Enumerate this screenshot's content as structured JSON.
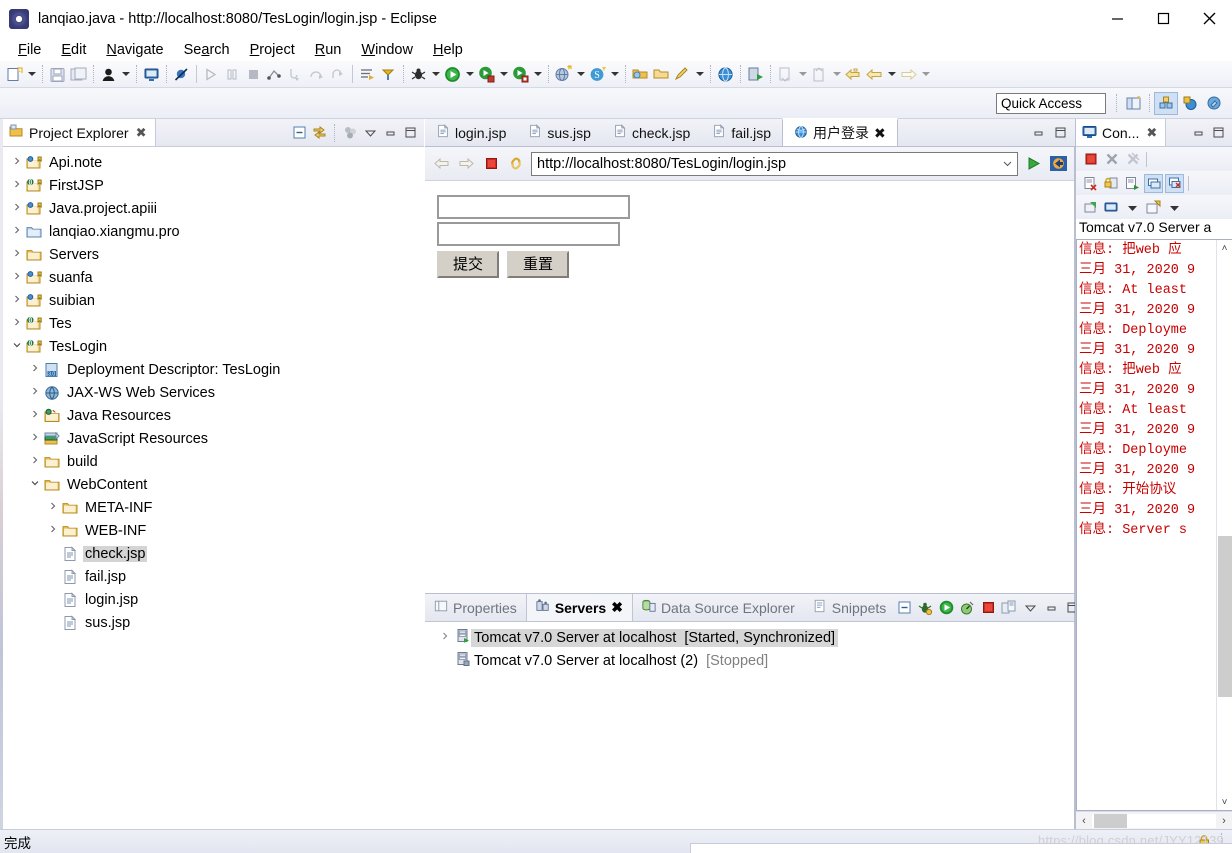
{
  "window": {
    "title": "lanqiao.java - http://localhost:8080/TesLogin/login.jsp - Eclipse",
    "app_icon": "eclipse-icon",
    "minimize": "–",
    "maximize": "☐",
    "close": "✕"
  },
  "menubar": {
    "items": [
      {
        "label": "File",
        "mnemonic": "F"
      },
      {
        "label": "Edit",
        "mnemonic": "E"
      },
      {
        "label": "Navigate",
        "mnemonic": "N"
      },
      {
        "label": "Search",
        "mnemonic": "a"
      },
      {
        "label": "Project",
        "mnemonic": "P"
      },
      {
        "label": "Run",
        "mnemonic": "R"
      },
      {
        "label": "Window",
        "mnemonic": "W"
      },
      {
        "label": "Help",
        "mnemonic": "H"
      }
    ]
  },
  "quick_access": {
    "value": "Quick Access",
    "placeholder": "Quick Access"
  },
  "explorer": {
    "tab_label": "Project Explorer",
    "close_glyph": "✖",
    "tree": [
      {
        "label": "Api.note",
        "indent": 0,
        "twist": "›",
        "icon": "java-project-icon"
      },
      {
        "label": "FirstJSP",
        "indent": 0,
        "twist": "›",
        "icon": "web-project-icon"
      },
      {
        "label": "Java.project.apiii",
        "indent": 0,
        "twist": "›",
        "icon": "java-project-icon"
      },
      {
        "label": "lanqiao.xiangmu.pro",
        "indent": 0,
        "twist": "›",
        "icon": "folder-blue-icon"
      },
      {
        "label": "Servers",
        "indent": 0,
        "twist": "›",
        "icon": "folder-icon"
      },
      {
        "label": "suanfa",
        "indent": 0,
        "twist": "›",
        "icon": "java-project-icon"
      },
      {
        "label": "suibian",
        "indent": 0,
        "twist": "›",
        "icon": "java-project-icon"
      },
      {
        "label": "Tes",
        "indent": 0,
        "twist": "›",
        "icon": "web-project-icon"
      },
      {
        "label": "TesLogin",
        "indent": 0,
        "twist": "⌄",
        "icon": "web-project-icon",
        "expanded": true
      },
      {
        "label": "Deployment Descriptor: TesLogin",
        "indent": 1,
        "twist": "›",
        "icon": "deployment-descriptor-icon"
      },
      {
        "label": "JAX-WS Web Services",
        "indent": 1,
        "twist": "›",
        "icon": "jaxws-icon"
      },
      {
        "label": "Java Resources",
        "indent": 1,
        "twist": "›",
        "icon": "java-resources-icon"
      },
      {
        "label": "JavaScript Resources",
        "indent": 1,
        "twist": "›",
        "icon": "javascript-resources-icon"
      },
      {
        "label": "build",
        "indent": 1,
        "twist": "›",
        "icon": "folder-icon"
      },
      {
        "label": "WebContent",
        "indent": 1,
        "twist": "⌄",
        "icon": "folder-icon",
        "expanded": true
      },
      {
        "label": "META-INF",
        "indent": 2,
        "twist": "›",
        "icon": "folder-icon"
      },
      {
        "label": "WEB-INF",
        "indent": 2,
        "twist": "›",
        "icon": "folder-icon"
      },
      {
        "label": "check.jsp",
        "indent": 2,
        "twist": "",
        "icon": "jsp-file-icon",
        "selected": true
      },
      {
        "label": "fail.jsp",
        "indent": 2,
        "twist": "",
        "icon": "jsp-file-icon"
      },
      {
        "label": "login.jsp",
        "indent": 2,
        "twist": "",
        "icon": "jsp-file-icon"
      },
      {
        "label": "sus.jsp",
        "indent": 2,
        "twist": "",
        "icon": "jsp-file-icon"
      }
    ]
  },
  "editor": {
    "tabs": [
      {
        "label": "login.jsp",
        "icon": "jsp-file-icon",
        "active": false
      },
      {
        "label": "sus.jsp",
        "icon": "jsp-file-icon",
        "active": false
      },
      {
        "label": "check.jsp",
        "icon": "jsp-file-icon",
        "active": false
      },
      {
        "label": "fail.jsp",
        "icon": "jsp-file-icon",
        "active": false
      },
      {
        "label": "用户登录",
        "icon": "browser-globe-icon",
        "active": true,
        "close_glyph": "✖"
      }
    ]
  },
  "browser": {
    "url": "http://localhost:8080/TesLogin/login.jsp",
    "back_icon": "back-arrow-icon",
    "forward_icon": "forward-arrow-icon",
    "stop_icon": "stop-square-icon",
    "refresh_icon": "refresh-link-icon",
    "go_icon": "go-play-icon",
    "open-external_icon": "open-external-browser-icon",
    "page": {
      "username_value": "",
      "password_value": "",
      "submit_label": "提交",
      "reset_label": "重置"
    }
  },
  "console": {
    "tab_label": "Con...",
    "close_glyph": "✖",
    "header": "Tomcat v7.0 Server a",
    "lines": [
      "信息: 把web 应",
      "三月 31, 2020 9",
      "信息: At least",
      "三月 31, 2020 9",
      "信息: Deployme",
      "三月 31, 2020 9",
      "信息: 把web 应",
      "三月 31, 2020 9",
      "信息: At least",
      "三月 31, 2020 9",
      "信息: Deployme",
      "三月 31, 2020 9",
      "信息: 开始协议",
      "三月 31, 2020 9",
      "信息: Server s"
    ],
    "scroll_up_glyph": "˄",
    "scroll_down_glyph": "˅",
    "scroll_left_glyph": "‹",
    "scroll_right_glyph": "›",
    "toolbar_icons": [
      "terminate-icon",
      "remove-launch-icon",
      "remove-all-terminated-icon",
      "clear-console-icon",
      "scroll-lock-icon",
      "show-console-on-output-icon",
      "pin-console-icon",
      "display-selected-console-icon",
      "open-console-icon",
      "new-console-view-icon"
    ]
  },
  "bottom_panel": {
    "tabs": [
      {
        "label": "Properties",
        "icon": "properties-icon",
        "active": false
      },
      {
        "label": "Servers",
        "icon": "servers-icon",
        "active": true,
        "close_glyph": "✖"
      },
      {
        "label": "Data Source Explorer",
        "icon": "data-source-icon",
        "active": false
      },
      {
        "label": "Snippets",
        "icon": "snippets-icon",
        "active": false
      }
    ],
    "toolbar_icons": [
      "collapse-all-icon",
      "debug-server-icon",
      "start-server-icon",
      "profile-server-icon",
      "stop-server-icon",
      "publish-icon",
      "view-menu-icon",
      "minimize-icon",
      "maximize-icon"
    ],
    "servers": [
      {
        "twist": "›",
        "icon": "server-started-icon",
        "name": "Tomcat v7.0 Server at localhost",
        "state": "[Started, Synchronized]",
        "selected": true
      },
      {
        "twist": "",
        "icon": "server-stopped-icon",
        "name": "Tomcat v7.0 Server at localhost (2)",
        "state": "[Stopped]",
        "selected": false,
        "stopped": true
      }
    ]
  },
  "statusbar": {
    "message": "完成",
    "watermark": "https://blog.csdn.net/JYY12139",
    "lock_icon": "writable-lock-icon"
  },
  "colors": {
    "console_text": "#c80000",
    "selection": "#d4d4d4",
    "accent_blue": "#cfe0f5",
    "chrome": "#eef0f7",
    "link_green": "#2f9e32"
  }
}
